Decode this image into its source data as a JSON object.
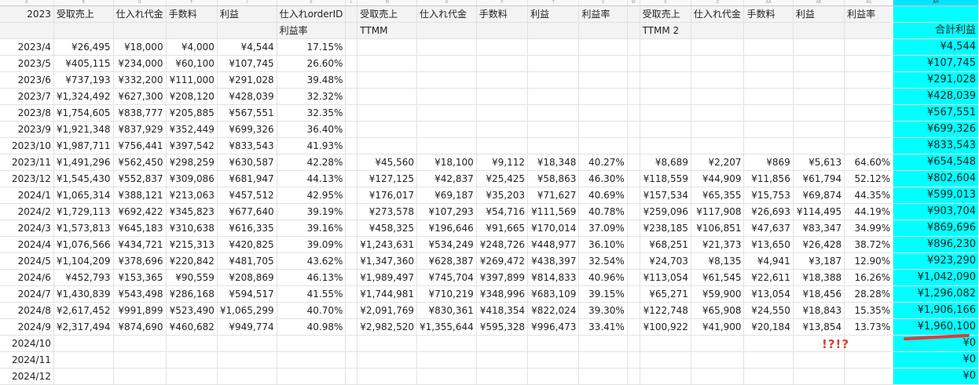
{
  "column_letters": {
    "A": "A",
    "B": "B",
    "D": "D",
    "F": "F",
    "I": "I",
    "K": "K",
    "L": "L",
    "M": "M",
    "O": "O",
    "P": "P",
    "T": "T",
    "V": "V",
    "W": "W",
    "X": "X",
    "Z": "Z",
    "AA": "AA",
    "AE": "AE",
    "AG": "AG",
    "AH": "AH"
  },
  "header1": {
    "year": "2023",
    "sales": "受取売上",
    "purchase": "仕入れ代金",
    "fee": "手数料",
    "profit": "利益",
    "orderid": "仕入れorderID",
    "sales2": "受取売上",
    "purchase2": "仕入れ代金",
    "fee2": "手数料",
    "profit2": "利益",
    "rate2": "利益率",
    "sales3": "受取売上",
    "purchase3": "仕入れ代金",
    "fee3": "手数料",
    "profit3": "利益",
    "rate3": "利益率"
  },
  "header2": {
    "rate": "利益率",
    "ttmm": "TTMM",
    "ttmm2": "TTMM 2",
    "total": "合計利益"
  },
  "rows": [
    {
      "m": "2023/4",
      "b": "¥26,495",
      "d": "¥18,000",
      "f": "¥4,000",
      "i": "¥4,544",
      "k": "17.15%",
      "m2": "",
      "o": "",
      "p": "",
      "t": "",
      "v": "",
      "x": "",
      "z": "",
      "aa": "",
      "ae": "",
      "ag": "",
      "ah": "¥4,544"
    },
    {
      "m": "2023/5",
      "b": "¥405,115",
      "d": "¥234,000",
      "f": "¥60,100",
      "i": "¥107,745",
      "k": "26.60%",
      "m2": "",
      "o": "",
      "p": "",
      "t": "",
      "v": "",
      "x": "",
      "z": "",
      "aa": "",
      "ae": "",
      "ag": "",
      "ah": "¥107,745"
    },
    {
      "m": "2023/6",
      "b": "¥737,193",
      "d": "¥332,200",
      "f": "¥111,000",
      "i": "¥291,028",
      "k": "39.48%",
      "m2": "",
      "o": "",
      "p": "",
      "t": "",
      "v": "",
      "x": "",
      "z": "",
      "aa": "",
      "ae": "",
      "ag": "",
      "ah": "¥291,028"
    },
    {
      "m": "2023/7",
      "b": "¥1,324,492",
      "d": "¥627,300",
      "f": "¥208,120",
      "i": "¥428,039",
      "k": "32.32%",
      "m2": "",
      "o": "",
      "p": "",
      "t": "",
      "v": "",
      "x": "",
      "z": "",
      "aa": "",
      "ae": "",
      "ag": "",
      "ah": "¥428,039"
    },
    {
      "m": "2023/8",
      "b": "¥1,754,605",
      "d": "¥838,777",
      "f": "¥205,885",
      "i": "¥567,551",
      "k": "32.35%",
      "m2": "",
      "o": "",
      "p": "",
      "t": "",
      "v": "",
      "x": "",
      "z": "",
      "aa": "",
      "ae": "",
      "ag": "",
      "ah": "¥567,551"
    },
    {
      "m": "2023/9",
      "b": "¥1,921,348",
      "d": "¥837,929",
      "f": "¥352,449",
      "i": "¥699,326",
      "k": "36.40%",
      "m2": "",
      "o": "",
      "p": "",
      "t": "",
      "v": "",
      "x": "",
      "z": "",
      "aa": "",
      "ae": "",
      "ag": "",
      "ah": "¥699,326"
    },
    {
      "m": "2023/10",
      "b": "¥1,987,711",
      "d": "¥756,441",
      "f": "¥397,542",
      "i": "¥833,543",
      "k": "41.93%",
      "m2": "",
      "o": "",
      "p": "",
      "t": "",
      "v": "",
      "x": "",
      "z": "",
      "aa": "",
      "ae": "",
      "ag": "",
      "ah": "¥833,543"
    },
    {
      "m": "2023/11",
      "b": "¥1,491,296",
      "d": "¥562,450",
      "f": "¥298,259",
      "i": "¥630,587",
      "k": "42.28%",
      "m2": "¥45,560",
      "o": "¥18,100",
      "p": "¥9,112",
      "t": "¥18,348",
      "v": "40.27%",
      "x": "¥8,689",
      "z": "¥2,207",
      "aa": "¥869",
      "ae": "¥5,613",
      "ag": "64.60%",
      "ah": "¥654,548"
    },
    {
      "m": "2023/12",
      "b": "¥1,545,430",
      "d": "¥552,837",
      "f": "¥309,086",
      "i": "¥681,947",
      "k": "44.13%",
      "m2": "¥127,125",
      "o": "¥42,837",
      "p": "¥25,425",
      "t": "¥58,863",
      "v": "46.30%",
      "x": "¥118,559",
      "z": "¥44,909",
      "aa": "¥11,856",
      "ae": "¥61,794",
      "ag": "52.12%",
      "ah": "¥802,604"
    },
    {
      "m": "2024/1",
      "b": "¥1,065,314",
      "d": "¥388,121",
      "f": "¥213,063",
      "i": "¥457,512",
      "k": "42.95%",
      "m2": "¥176,017",
      "o": "¥69,187",
      "p": "¥35,203",
      "t": "¥71,627",
      "v": "40.69%",
      "x": "¥157,534",
      "z": "¥65,355",
      "aa": "¥15,753",
      "ae": "¥69,874",
      "ag": "44.35%",
      "ah": "¥599,013"
    },
    {
      "m": "2024/2",
      "b": "¥1,729,113",
      "d": "¥692,422",
      "f": "¥345,823",
      "i": "¥677,640",
      "k": "39.19%",
      "m2": "¥273,578",
      "o": "¥107,293",
      "p": "¥54,716",
      "t": "¥111,569",
      "v": "40.78%",
      "x": "¥259,096",
      "z": "¥117,908",
      "aa": "¥26,693",
      "ae": "¥114,495",
      "ag": "44.19%",
      "ah": "¥903,704"
    },
    {
      "m": "2024/3",
      "b": "¥1,573,813",
      "d": "¥645,183",
      "f": "¥310,638",
      "i": "¥616,335",
      "k": "39.16%",
      "m2": "¥458,325",
      "o": "¥196,646",
      "p": "¥91,665",
      "t": "¥170,014",
      "v": "37.09%",
      "x": "¥238,185",
      "z": "¥106,851",
      "aa": "¥47,637",
      "ae": "¥83,347",
      "ag": "34.99%",
      "ah": "¥869,696"
    },
    {
      "m": "2024/4",
      "b": "¥1,076,566",
      "d": "¥434,721",
      "f": "¥215,313",
      "i": "¥420,825",
      "k": "39.09%",
      "m2": "¥1,243,631",
      "o": "¥534,249",
      "p": "¥248,726",
      "t": "¥448,977",
      "v": "36.10%",
      "x": "¥68,251",
      "z": "¥21,373",
      "aa": "¥13,650",
      "ae": "¥26,428",
      "ag": "38.72%",
      "ah": "¥896,230"
    },
    {
      "m": "2024/5",
      "b": "¥1,104,209",
      "d": "¥378,696",
      "f": "¥220,842",
      "i": "¥481,705",
      "k": "43.62%",
      "m2": "¥1,347,360",
      "o": "¥628,387",
      "p": "¥269,472",
      "t": "¥438,397",
      "v": "32.54%",
      "x": "¥24,703",
      "z": "¥8,135",
      "aa": "¥4,941",
      "ae": "¥3,187",
      "ag": "12.90%",
      "ah": "¥923,290"
    },
    {
      "m": "2024/6",
      "b": "¥452,793",
      "d": "¥153,365",
      "f": "¥90,559",
      "i": "¥208,869",
      "k": "46.13%",
      "m2": "¥1,989,497",
      "o": "¥745,704",
      "p": "¥397,899",
      "t": "¥814,833",
      "v": "40.96%",
      "x": "¥113,054",
      "z": "¥61,545",
      "aa": "¥22,611",
      "ae": "¥18,388",
      "ag": "16.26%",
      "ah": "¥1,042,090"
    },
    {
      "m": "2024/7",
      "b": "¥1,430,839",
      "d": "¥543,498",
      "f": "¥286,168",
      "i": "¥594,517",
      "k": "41.55%",
      "m2": "¥1,744,981",
      "o": "¥710,219",
      "p": "¥348,996",
      "t": "¥683,109",
      "v": "39.15%",
      "x": "¥65,271",
      "z": "¥59,900",
      "aa": "¥13,054",
      "ae": "¥18,456",
      "ag": "28.28%",
      "ah": "¥1,296,082"
    },
    {
      "m": "2024/8",
      "b": "¥2,617,452",
      "d": "¥991,899",
      "f": "¥523,490",
      "i": "¥1,065,299",
      "k": "40.70%",
      "m2": "¥2,091,769",
      "o": "¥830,361",
      "p": "¥418,354",
      "t": "¥822,024",
      "v": "39.30%",
      "x": "¥122,748",
      "z": "¥65,908",
      "aa": "¥24,550",
      "ae": "¥18,843",
      "ag": "15.35%",
      "ah": "¥1,906,166"
    },
    {
      "m": "2024/9",
      "b": "¥2,317,494",
      "d": "¥874,690",
      "f": "¥460,682",
      "i": "¥949,774",
      "k": "40.98%",
      "m2": "¥2,982,520",
      "o": "¥1,355,644",
      "p": "¥595,328",
      "t": "¥996,473",
      "v": "33.41%",
      "x": "¥100,922",
      "z": "¥41,900",
      "aa": "¥20,184",
      "ae": "¥13,854",
      "ag": "13.73%",
      "ah": "¥1,960,100"
    },
    {
      "m": "2024/10",
      "b": "",
      "d": "",
      "f": "",
      "i": "",
      "k": "",
      "m2": "",
      "o": "",
      "p": "",
      "t": "",
      "v": "",
      "x": "",
      "z": "",
      "aa": "",
      "ae": "",
      "ag": "",
      "ah": "¥0"
    },
    {
      "m": "2024/11",
      "b": "",
      "d": "",
      "f": "",
      "i": "",
      "k": "",
      "m2": "",
      "o": "",
      "p": "",
      "t": "",
      "v": "",
      "x": "",
      "z": "",
      "aa": "",
      "ae": "",
      "ag": "",
      "ah": "¥0"
    },
    {
      "m": "2024/12",
      "b": "",
      "d": "",
      "f": "",
      "i": "",
      "k": "",
      "m2": "",
      "o": "",
      "p": "",
      "t": "",
      "v": "",
      "x": "",
      "z": "",
      "aa": "",
      "ae": "",
      "ag": "",
      "ah": "¥0"
    }
  ],
  "annotation": "!?!?",
  "colors": {
    "total_column": "#00ffff",
    "annotation": "#e53935",
    "header_bg": "#f3f3f3"
  }
}
